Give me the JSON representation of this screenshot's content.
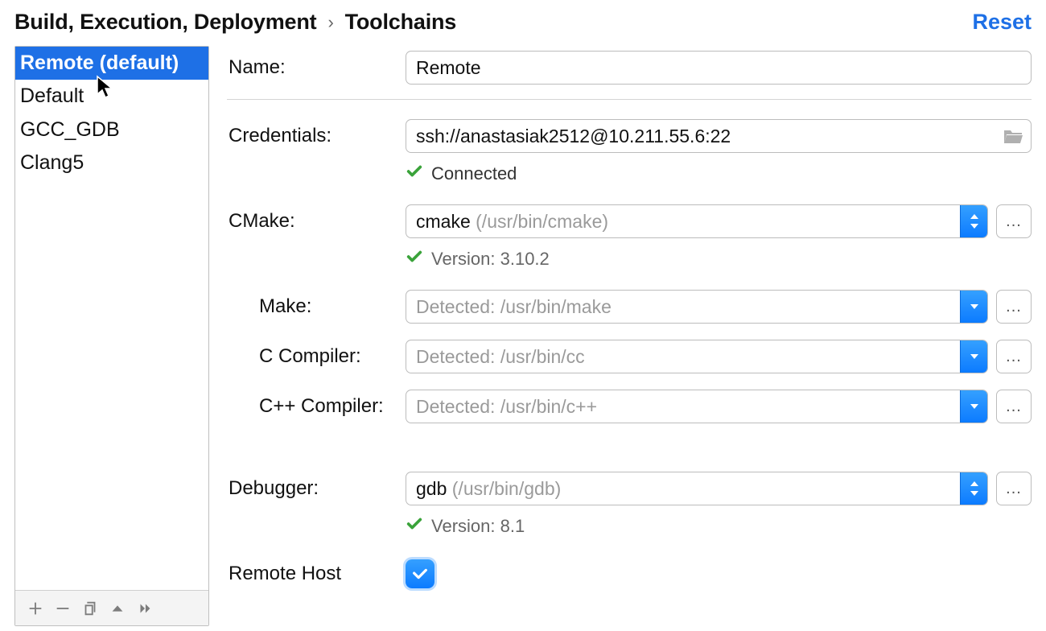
{
  "breadcrumb": {
    "parent": "Build, Execution, Deployment",
    "current": "Toolchains",
    "sep": "›"
  },
  "reset_label": "Reset",
  "sidebar": {
    "items": [
      {
        "label": "Remote (default)",
        "selected": true
      },
      {
        "label": "Default",
        "selected": false
      },
      {
        "label": "GCC_GDB",
        "selected": false
      },
      {
        "label": "Clang5",
        "selected": false
      }
    ]
  },
  "form": {
    "name_label": "Name:",
    "name_value": "Remote",
    "credentials_label": "Credentials:",
    "credentials_value": "ssh://anastasiak2512@10.211.55.6:22",
    "connected_status": "Connected",
    "cmake_label": "CMake:",
    "cmake_value": "cmake",
    "cmake_hint": "(/usr/bin/cmake)",
    "cmake_status": "Version: 3.10.2",
    "make_label": "Make:",
    "make_placeholder": "Detected: /usr/bin/make",
    "cc_label": "C Compiler:",
    "cc_placeholder": "Detected: /usr/bin/cc",
    "cxx_label": "C++ Compiler:",
    "cxx_placeholder": "Detected: /usr/bin/c++",
    "debugger_label": "Debugger:",
    "debugger_value": "gdb",
    "debugger_hint": "(/usr/bin/gdb)",
    "debugger_status": "Version: 8.1",
    "remote_host_label": "Remote Host",
    "remote_host_checked": true,
    "ellipsis": "..."
  }
}
